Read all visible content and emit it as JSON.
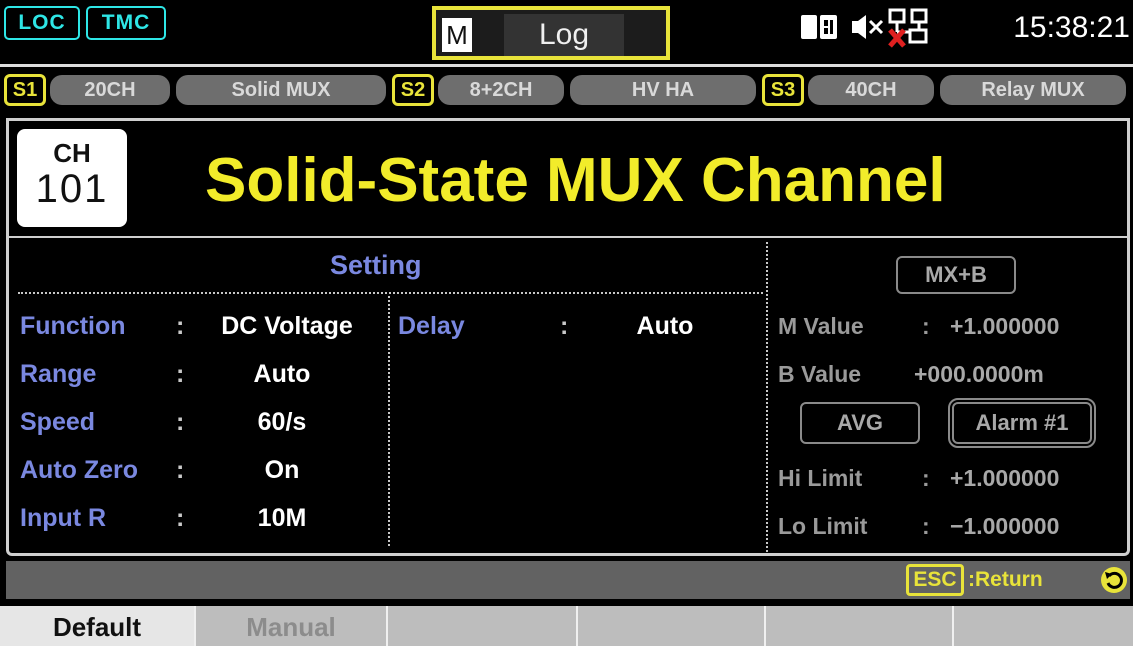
{
  "status_bar": {
    "loc_label": "LOC",
    "tmc_label": "TMC",
    "mode_badge": "M",
    "mode_label": "Log",
    "icons": [
      "sd-card-icon",
      "mute-icon",
      "lan-disconnected-icon"
    ],
    "time": "15:38:21"
  },
  "slots": [
    {
      "badge": "S1",
      "channels": "20CH",
      "type": "Solid MUX"
    },
    {
      "badge": "S2",
      "channels": "8+2CH",
      "type": "HV HA"
    },
    {
      "badge": "S3",
      "channels": "40CH",
      "type": "Relay MUX"
    }
  ],
  "channel": {
    "word": "CH",
    "number": "101"
  },
  "title": "Solid-State MUX Channel",
  "setting": {
    "heading": "Setting",
    "rows": [
      {
        "label": "Function",
        "value": "DC Voltage"
      },
      {
        "label": "Range",
        "value": "Auto"
      },
      {
        "label": "Speed",
        "value": "60/s"
      },
      {
        "label": "Auto Zero",
        "value": "On"
      },
      {
        "label": "Input R",
        "value": "10M"
      }
    ],
    "delay": {
      "label": "Delay",
      "value": "Auto"
    }
  },
  "math": {
    "mxb_button": "MX+B",
    "m_label": "M Value",
    "m_value": "+1.000000",
    "b_label": "B Value",
    "b_value": "+000.0000m",
    "avg_button": "AVG",
    "alarm_button": "Alarm #1",
    "hi_label": "Hi Limit",
    "hi_value": "+1.000000",
    "lo_label": "Lo Limit",
    "lo_value": "−1.000000"
  },
  "esc": {
    "key": "ESC",
    "label": ":Return"
  },
  "softkeys": [
    "Default",
    "Manual"
  ],
  "colors": {
    "accent_yellow": "#f2ec2a",
    "label_blue": "#7a88e0",
    "cyan": "#2ee6e6"
  }
}
